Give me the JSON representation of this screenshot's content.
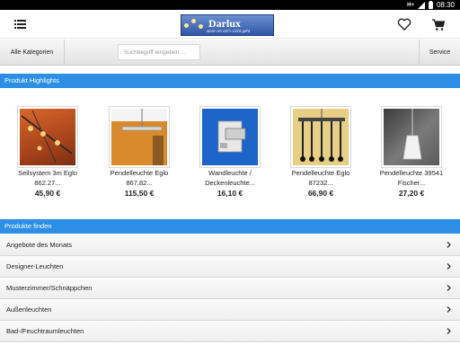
{
  "status": {
    "network": "H+",
    "time": "08:30"
  },
  "header": {
    "logo_name": "Darlux",
    "logo_tagline": "wenn es um's Licht geht"
  },
  "searchbar": {
    "categories_label": "Alle Kategorien",
    "search_placeholder": "Suchbegriff eingeben ...",
    "service_label": "Service"
  },
  "highlights": {
    "title": "Produkt Highlights",
    "products": [
      {
        "name_line1": "Seilsystem 3m Eglo",
        "name_line2": "862.27...",
        "price": "45,90 €"
      },
      {
        "name_line1": "Pendelleuchte Eglo",
        "name_line2": "867.82...",
        "price": "115,50 €"
      },
      {
        "name_line1": "Wandleuchte /",
        "name_line2": "Deckenleuchte...",
        "price": "16,10 €"
      },
      {
        "name_line1": "Pendelleuchte Eglo",
        "name_line2": "87232...",
        "price": "66,90 €"
      },
      {
        "name_line1": "Pendelleuchte 39541",
        "name_line2": "Fischer...",
        "price": "27,20 €"
      }
    ]
  },
  "finder": {
    "title": "Produkte finden",
    "items": [
      {
        "label": "Angebote des Monats"
      },
      {
        "label": "Designer-Leuchten"
      },
      {
        "label": "Musterzimmer/Schnäppchen"
      },
      {
        "label": "Außenleuchten"
      },
      {
        "label": "Bad-/Feuchtraumleuchten"
      }
    ]
  },
  "icons": {
    "menu": "menu-icon",
    "favorites": "heart-icon",
    "cart": "cart-icon",
    "row_arrow": "chevron-right-icon"
  },
  "colors": {
    "accent": "#2d8ee6",
    "text": "#222222"
  }
}
